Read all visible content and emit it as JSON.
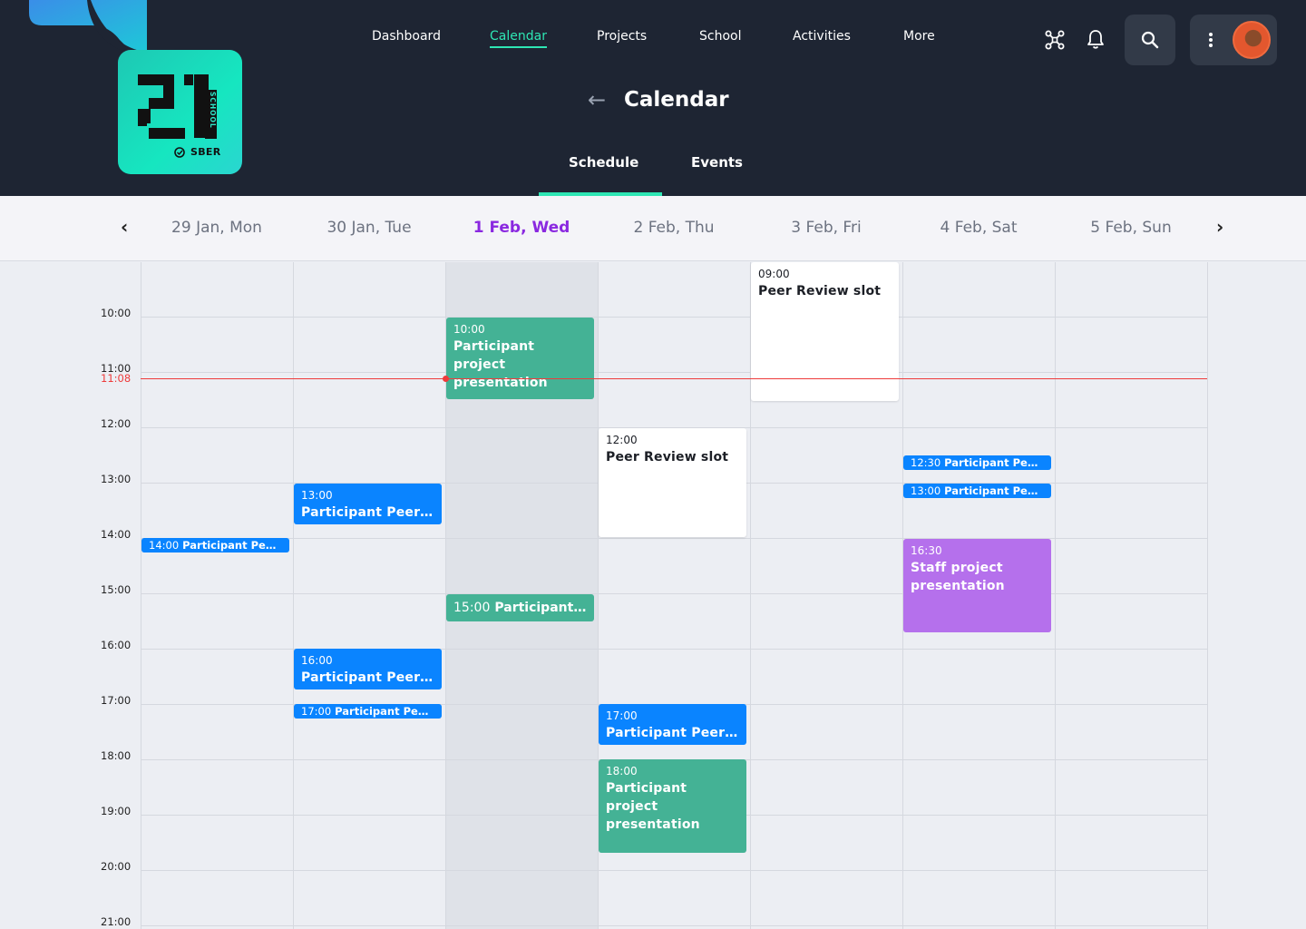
{
  "nav": {
    "items": [
      {
        "label": "Dashboard"
      },
      {
        "label": "Calendar",
        "active": true
      },
      {
        "label": "Projects"
      },
      {
        "label": "School"
      },
      {
        "label": "Activities"
      },
      {
        "label": "More"
      }
    ]
  },
  "logo": {
    "brand": "SBER",
    "number": "21",
    "word": "SCHOOL"
  },
  "page": {
    "title": "Calendar",
    "back_icon": "arrow-left-icon"
  },
  "tabs": [
    {
      "label": "Schedule",
      "active": true
    },
    {
      "label": "Events"
    }
  ],
  "days": [
    {
      "label": "29 Jan, Mon"
    },
    {
      "label": "30 Jan, Tue"
    },
    {
      "label": "1 Feb, Wed",
      "today": true
    },
    {
      "label": "2 Feb, Thu"
    },
    {
      "label": "3 Feb, Fri"
    },
    {
      "label": "4 Feb, Sat"
    },
    {
      "label": "5 Feb, Sun"
    }
  ],
  "hours": [
    "10:00",
    "11:00",
    "12:00",
    "13:00",
    "14:00",
    "15:00",
    "16:00",
    "17:00",
    "18:00",
    "19:00",
    "20:00",
    "21:00"
  ],
  "now": "11:08",
  "events": [
    {
      "time": "09:00",
      "title": "Peer Review slot"
    },
    {
      "time": "10:00",
      "title": "Participant project presentation"
    },
    {
      "time": "12:00",
      "title": "Peer Review slot"
    },
    {
      "time": "12:30",
      "title": "Participant Peer…"
    },
    {
      "time": "13:00",
      "title": "Participant Peer…"
    },
    {
      "time": "13:00",
      "title": "Participant Peer…"
    },
    {
      "time": "14:00",
      "title": "Participant Peer…"
    },
    {
      "time": "15:00",
      "title": "Participant…"
    },
    {
      "time": "16:30",
      "title": "Staff project presentation"
    },
    {
      "time": "16:00",
      "title": "Participant Peer…"
    },
    {
      "time": "17:00",
      "title": "Participant Peer…"
    },
    {
      "time": "17:00",
      "title": "Participant Peer …"
    },
    {
      "time": "18:00",
      "title": "Participant  project presentation"
    }
  ],
  "colors": {
    "header_bg": "#1e2533",
    "accent": "#2ee6b4",
    "today": "#8a28e0",
    "event_green": "#44b295",
    "event_blue": "#0a84ff",
    "event_purple": "#b570ec",
    "now_line": "#ee3b3b"
  }
}
